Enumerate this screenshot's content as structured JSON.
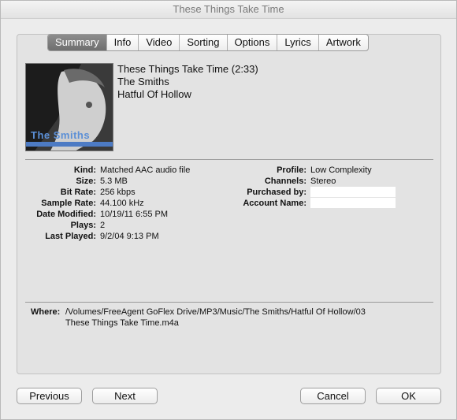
{
  "window": {
    "title": "These Things Take Time"
  },
  "tabs": [
    {
      "label": "Summary",
      "active": true
    },
    {
      "label": "Info"
    },
    {
      "label": "Video"
    },
    {
      "label": "Sorting"
    },
    {
      "label": "Options"
    },
    {
      "label": "Lyrics"
    },
    {
      "label": "Artwork"
    }
  ],
  "artwork": {
    "text": "The Smiths"
  },
  "track": {
    "title_line": "These Things Take Time (2:33)",
    "artist": "The Smiths",
    "album": "Hatful Of Hollow"
  },
  "details_left": [
    {
      "label": "Kind:",
      "value": "Matched AAC audio file"
    },
    {
      "label": "Size:",
      "value": "5.3 MB"
    },
    {
      "label": "Bit Rate:",
      "value": "256 kbps"
    },
    {
      "label": "Sample Rate:",
      "value": "44.100 kHz"
    },
    {
      "label": "Date Modified:",
      "value": "10/19/11 6:55 PM"
    },
    {
      "label": "Plays:",
      "value": "2"
    },
    {
      "label": "Last Played:",
      "value": "9/2/04 9:13 PM"
    }
  ],
  "details_right": [
    {
      "label": "Profile:",
      "value": "Low Complexity"
    },
    {
      "label": "Channels:",
      "value": "Stereo"
    },
    {
      "label": "Purchased by:",
      "value": ""
    },
    {
      "label": "Account Name:",
      "value": ""
    }
  ],
  "where": {
    "label": "Where:",
    "line1": "/Volumes/FreeAgent GoFlex Drive/MP3/Music/The Smiths/Hatful Of Hollow/03",
    "line2": "These Things Take Time.m4a"
  },
  "buttons": {
    "previous": "Previous",
    "next": "Next",
    "cancel": "Cancel",
    "ok": "OK"
  }
}
